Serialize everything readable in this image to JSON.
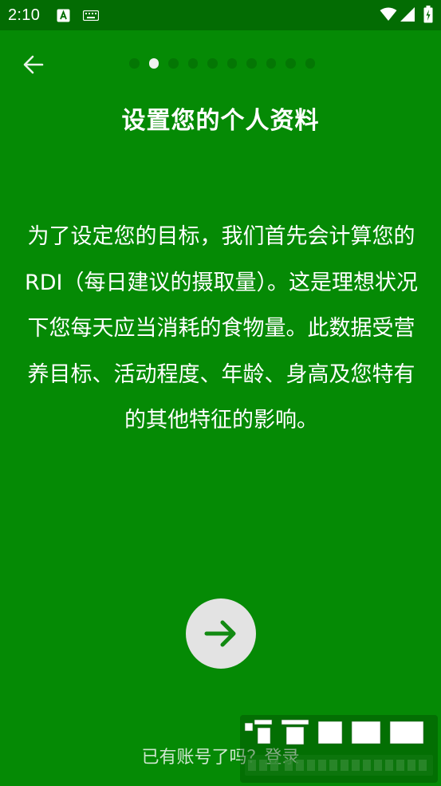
{
  "status_bar": {
    "time": "2:10",
    "icons": [
      "a-letter-icon",
      "keyboard-icon",
      "wifi-icon",
      "signal-icon",
      "battery-icon"
    ]
  },
  "header": {
    "back_icon": "arrow-left-icon",
    "pagination": {
      "total": 10,
      "active_index": 1
    },
    "title": "设置您的个人资料"
  },
  "main": {
    "description": "为了设定您的目标，我们首先会计算您的 RDI（每日建议的摄取量）。这是理想状况下您每天应当消耗的食物量。此数据受营养目标、活动程度、年龄、身高及您特有的其他特征的影响。"
  },
  "actions": {
    "next_icon": "arrow-right-icon",
    "login_link": "已有账号了吗？登录"
  },
  "watermark": {
    "brand": "谷普软件园",
    "url": "www.gupuxlazal.com"
  },
  "colors": {
    "background": "#058a05",
    "status_bar": "#036c03",
    "accent_arrow": "#128a12",
    "button_bg": "#e3e3e3"
  }
}
